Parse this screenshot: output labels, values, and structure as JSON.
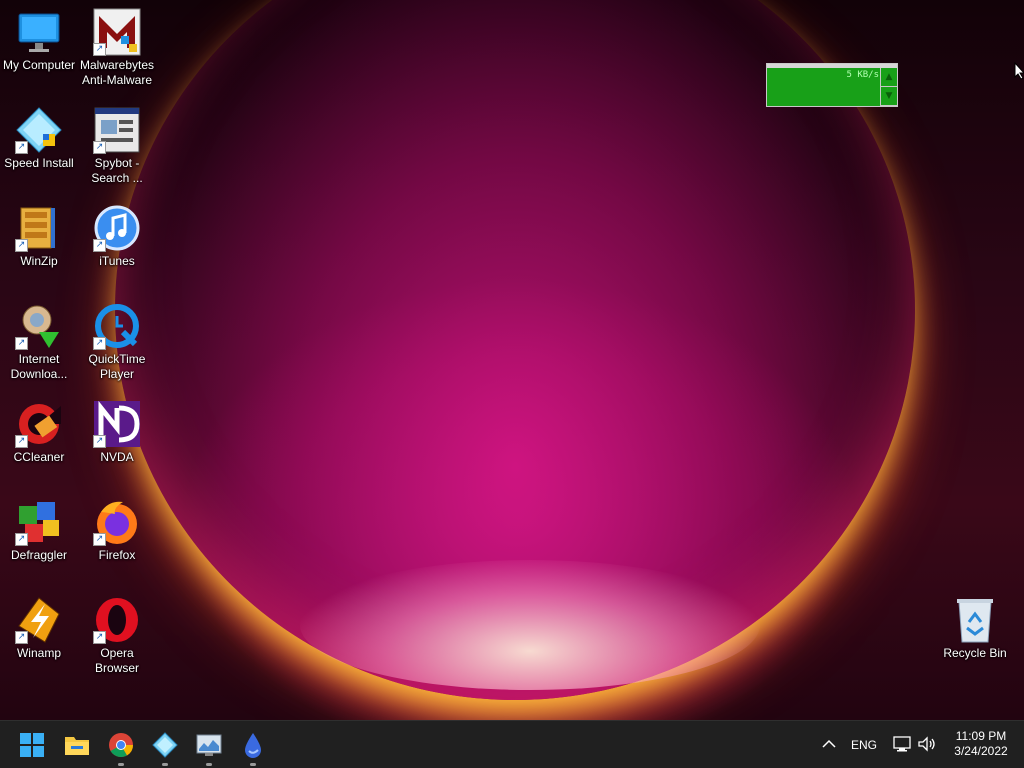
{
  "desktop": {
    "icons": [
      {
        "label": "My Computer",
        "icon": "monitor-icon"
      },
      {
        "label": "Malwarebytes Anti-Malware",
        "icon": "malwarebytes-icon"
      },
      {
        "label": "Speed Install",
        "icon": "speed-install-icon"
      },
      {
        "label": "Spybot - Search ...",
        "icon": "spybot-icon"
      },
      {
        "label": "WinZip",
        "icon": "winzip-icon"
      },
      {
        "label": "iTunes",
        "icon": "itunes-icon"
      },
      {
        "label": "Internet Downloa...",
        "icon": "internet-download-manager-icon"
      },
      {
        "label": "QuickTime Player",
        "icon": "quicktime-icon"
      },
      {
        "label": "CCleaner",
        "icon": "ccleaner-icon"
      },
      {
        "label": "NVDA",
        "icon": "nvda-icon"
      },
      {
        "label": "Defraggler",
        "icon": "defraggler-icon"
      },
      {
        "label": "Firefox",
        "icon": "firefox-icon"
      },
      {
        "label": "Winamp",
        "icon": "winamp-icon"
      },
      {
        "label": "Opera Browser",
        "icon": "opera-icon"
      },
      {
        "label": "Recycle Bin",
        "icon": "recycle-bin-icon"
      }
    ],
    "net_widget": {
      "speed": "5 KB/s"
    }
  },
  "taskbar": {
    "apps": [
      "start-icon",
      "file-explorer-icon",
      "chrome-icon",
      "speed-install-icon",
      "monitor-app-icon",
      "water-drop-icon"
    ],
    "tray": {
      "language": "ENG",
      "time": "11:09 PM",
      "date": "3/24/2022"
    }
  },
  "colors": {
    "taskbar_bg": "#202020",
    "widget_green": "#18a018"
  }
}
